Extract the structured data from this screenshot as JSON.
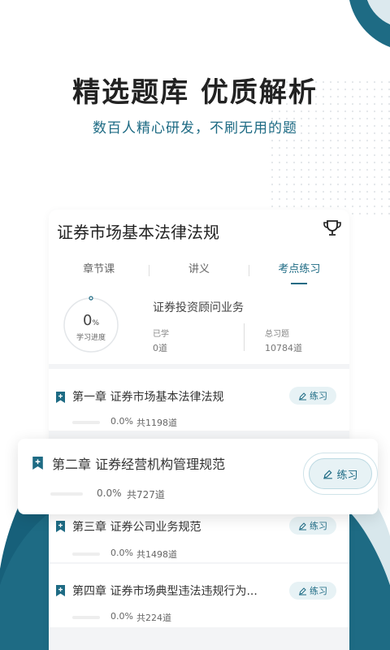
{
  "hero": {
    "title": "精选题库 优质解析",
    "subtitle": "数百人精心研发，不刷无用的题"
  },
  "colors": {
    "accent": "#1e6b84",
    "accent_light": "#e7f2f5",
    "wave_dark": "#17607a"
  },
  "subject": {
    "title": "证券市场基本法律法规",
    "trophy_icon": "trophy-icon"
  },
  "tabs": [
    {
      "label": "章节课",
      "active": false
    },
    {
      "label": "讲义",
      "active": false
    },
    {
      "label": "考点练习",
      "active": true
    }
  ],
  "progress": {
    "value": "0",
    "unit": "%",
    "label": "学习进度",
    "fraction": 0.0
  },
  "qualification": {
    "name": "证券投资顾问业务",
    "learned_label": "已学",
    "learned_value": "0道",
    "total_label": "总习题",
    "total_value": "10784道"
  },
  "chapters": [
    {
      "title": "第一章 证券市场基本法律法规",
      "percent": "0.0%",
      "count": "共1198道",
      "button": "练习"
    },
    {
      "title": "第二章 证券经营机构管理规范",
      "percent": "0.0%",
      "count": "共727道",
      "button": "练习"
    },
    {
      "title": "第三章 证券公司业务规范",
      "percent": "0.0%",
      "count": "共1498道",
      "button": "练习"
    },
    {
      "title": "第四章 证券市场典型违法违规行为...",
      "percent": "0.0%",
      "count": "共224道",
      "button": "练习"
    }
  ]
}
